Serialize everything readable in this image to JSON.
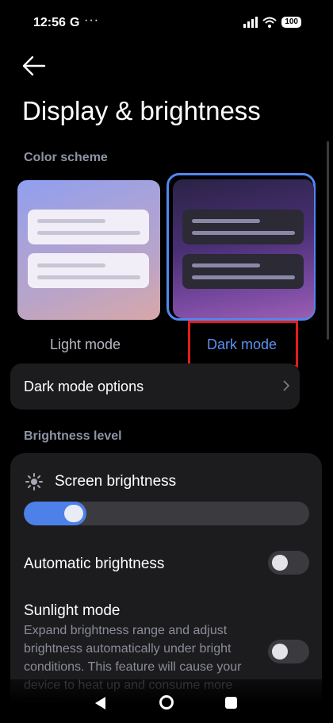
{
  "status_bar": {
    "time": "12:56",
    "g_icon": "G",
    "more": "···",
    "battery": "100",
    "icons": [
      "signal-icon",
      "wifi-icon",
      "battery-icon"
    ]
  },
  "header": {
    "title": "Display & brightness",
    "back_icon": "back-arrow-icon"
  },
  "color_scheme": {
    "label": "Color scheme",
    "options": [
      {
        "label": "Light mode",
        "selected": false
      },
      {
        "label": "Dark mode",
        "selected": true
      }
    ],
    "accent": "#4f88f0",
    "highlight_color": "#e31c1c"
  },
  "dark_mode_options": {
    "label": "Dark mode options",
    "icon": "chevron-right-icon"
  },
  "brightness": {
    "label": "Brightness level",
    "screen_brightness_label": "Screen brightness",
    "screen_brightness_value": 0.18,
    "automatic_label": "Automatic brightness",
    "automatic_on": false,
    "sunlight_label": "Sunlight mode",
    "sunlight_desc": "Expand brightness range and adjust brightness automatically under bright conditions. This feature will cause your device to heat up and consume more power.",
    "sunlight_on": false
  },
  "nav_bar": {
    "icons": [
      "nav-back-icon",
      "nav-home-icon",
      "nav-recents-icon"
    ]
  }
}
